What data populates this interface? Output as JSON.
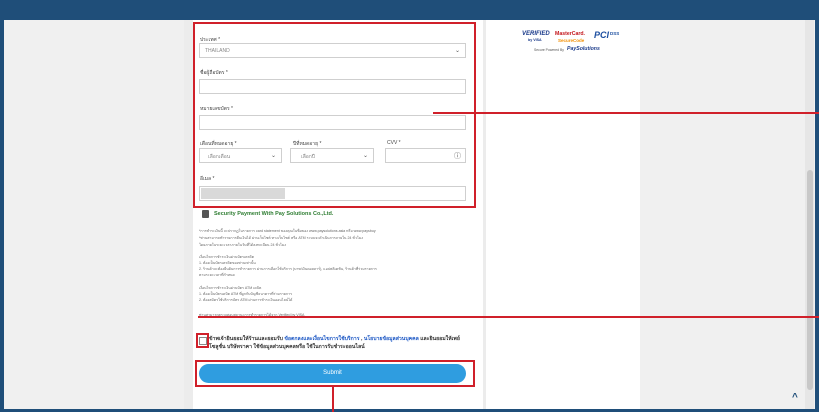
{
  "form": {
    "country_label": "ประเทศ *",
    "country_value": "THAILAND",
    "cardname_label": "ชื่อผู้ถือบัตร *",
    "cardnumber_label": "หมายเลขบัตร *",
    "exp_month_label": "เดือนที่หมดอายุ *",
    "exp_month_value": "เลือกเดือน",
    "exp_year_label": "ปีที่หมดอายุ *",
    "exp_year_value": "เลือกปี",
    "cvv_label": "CVV *",
    "email_label": "อีเมล *",
    "help_icon": "question-circle-icon"
  },
  "secure": {
    "title": "Security Payment With Pay Solutions Co.,Ltd.",
    "icon": "lock-icon"
  },
  "notes": {
    "para1": "*การชำระเงินนี้ จะปรากฏในรายการ card statement ของคุณในชื่อของ www.paysolutions.asia หรือ www.paysbuy",
    "para2": "*ท่านสามารถทำรายการคืนเงินได้ ผ่านเว็บไซต์ ทางเว็บไซต์ หรือ ATM ระบบจะดำเนินการภายใน 24 ชั่วโมง",
    "para3": "โดยภายในระยะเวลาภายในวันที่ได้ลงทะเบียน 24 ชั่วโมง",
    "sec1_title": "เงื่อนไขการชำระเงินผ่านบัตรเครดิต",
    "sec1_line1": "1. ต้องเป็นบัตรเครดิตของท่านเท่านั้น",
    "sec1_line2": "2. ร้านค้าจะต้องยืนยันการทำรายการ ผ่านการเลือกใช้บริการ (บาท/เงินดอลลาร์), แอปพลิเคชัน, ร้านค้าที่ร่วมรายการ",
    "sec1_line3": "ตามระยะเวลาที่กำหนด",
    "sec2_title": "เงื่อนไขการชำระเงินผ่านบัตร ATM เดบิต",
    "sec2_line1": "1. ต้องเป็นบัตรเดบิต ATM ที่ผูกกับบัญชีธนาคารที่ร่วมรายการ",
    "sec2_line2": "2. ต้องสมัครใช้บริการบัตร ATM ผ่านการชำระเงินออนไลน์ได้",
    "para4": "ท่านสามารถตรวจสอบสถานะการทำรายการได้จาก Verified by VISA",
    "consent_prefix": "ข้าพเจ้ายินยอมให้ร้านและยอมรับ ",
    "consent_link1": "ข้อตกลงและเงื่อนไขการใช้บริการ",
    "consent_mid": " , ",
    "consent_link2": "นโยบายข้อมูลส่วนบุคคล",
    "consent_suffix": " และยินยอมให้เพย์ โซลูชั่น บริษัทราคา ใช้ข้อมูลส่วนบุคคลหรือ ใช้ในการรับชำระออนไลน์"
  },
  "submit_label": "Submit",
  "badges": {
    "verified": "VERIFIED",
    "verified_sub": "by VISA",
    "mastercard": "MasterCard.",
    "securecode": "SecureCode",
    "pci": "PCI",
    "dss": "DSS",
    "secure_powered": "Secure Powered By",
    "paysolutions": "PaySolutions"
  },
  "scroll_top_icon": "chevron-up-icon",
  "colors": {
    "frame": "#1f4e79",
    "highlight": "#d0202a",
    "submit": "#2f9de0",
    "secure_green": "#2e7d32",
    "link": "#1a56c4"
  }
}
